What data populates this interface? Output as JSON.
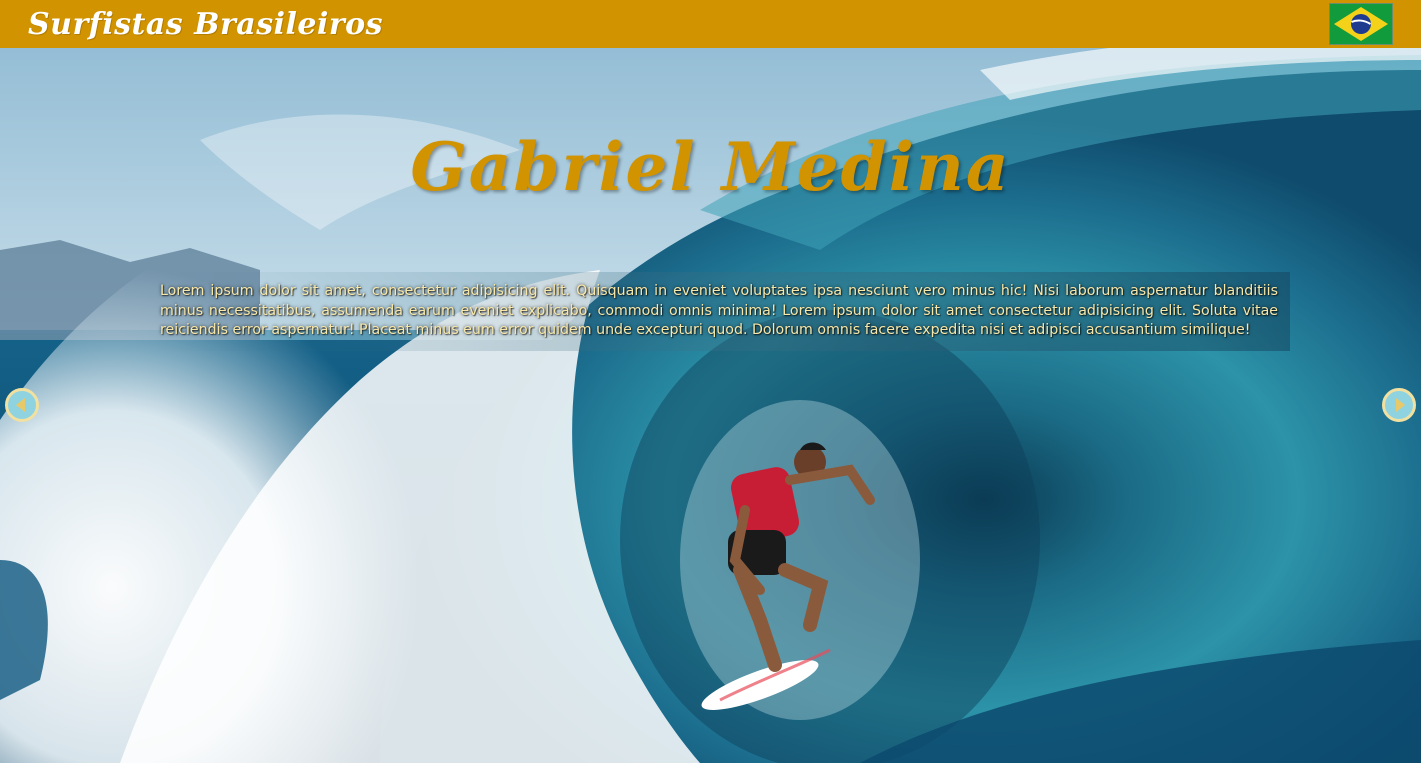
{
  "header": {
    "site_title": "Surfistas Brasileiros",
    "flag_icon": "brazil-flag-icon"
  },
  "hero": {
    "background_image": "surfer-in-barrel-wave",
    "headline": "Gabriel Medina",
    "paragraph": "Lorem ipsum dolor sit amet, consectetur adipisicing elit. Quisquam in eveniet voluptates ipsa nesciunt vero minus hic! Nisi laborum aspernatur blanditiis minus necessitatibus, assumenda earum eveniet explicabo, commodi omnis minima! Lorem ipsum dolor sit amet consectetur adipisicing elit. Soluta vitae reiciendis error aspernatur! Placeat minus eum error quidem unde excepturi quod. Dolorum omnis facere expedita nisi et adipisci accusantium similique!"
  },
  "carousel": {
    "prev_icon": "chevron-left-icon",
    "next_icon": "chevron-right-icon"
  },
  "colors": {
    "header_bg": "#d29300",
    "headline": "#d29300",
    "paragraph_text": "#f7e7a8",
    "arrow_fill": "#8fd3e0",
    "arrow_border": "#f1e0a0"
  }
}
